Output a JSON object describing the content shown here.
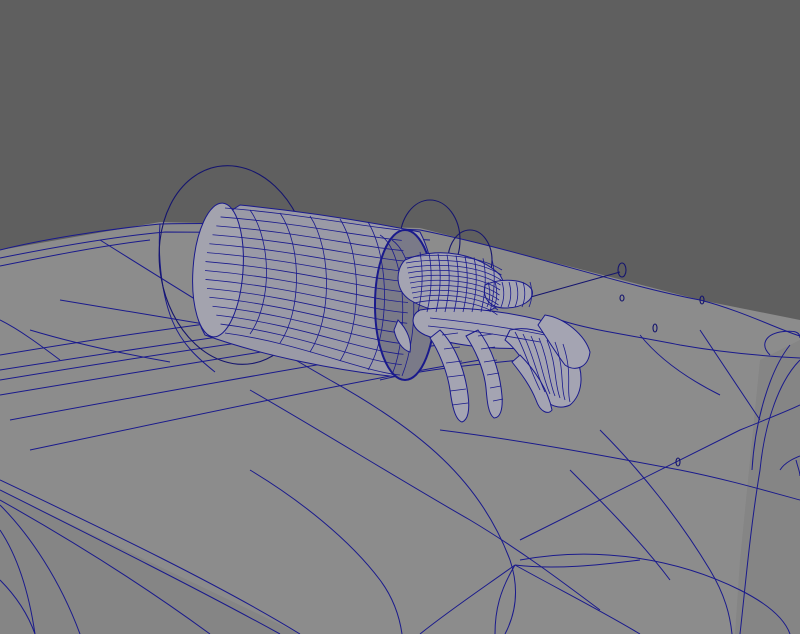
{
  "viewport": {
    "background_color": "#5f5f5f",
    "surface_color": "#8c8c8c",
    "surface_side_color": "#858585",
    "wireframe_color": "#1a1a8c",
    "controller_color": "#15156e"
  },
  "scene": {
    "objects": [
      {
        "name": "ground-plane",
        "kind": "wireframe-mesh"
      },
      {
        "name": "shell",
        "kind": "wireframe-cylinder"
      },
      {
        "name": "hermit-crab",
        "kind": "wireframe-mesh"
      },
      {
        "name": "rig-controllers",
        "kind": "nurbs-curves"
      }
    ]
  }
}
